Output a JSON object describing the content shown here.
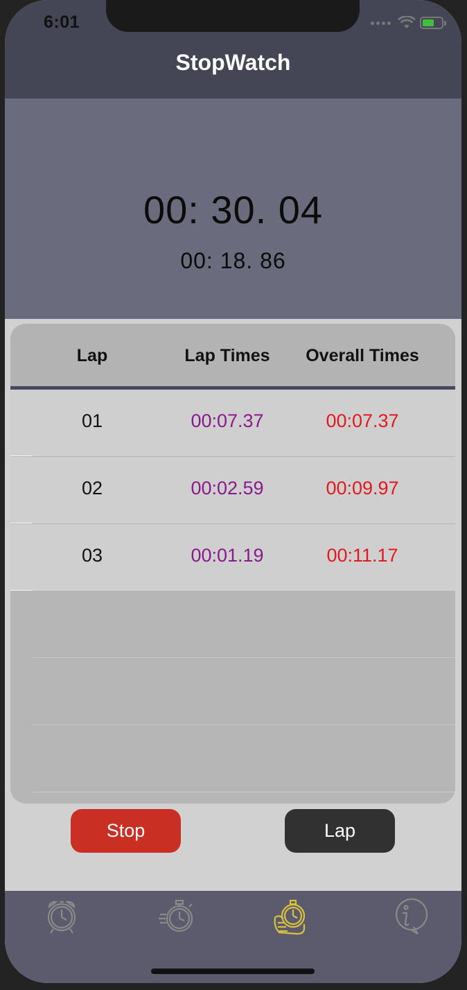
{
  "status_bar": {
    "time": "6:01"
  },
  "header": {
    "title": "StopWatch"
  },
  "timer": {
    "main": "00: 30. 04",
    "lap": "00: 18. 86"
  },
  "table": {
    "headers": [
      "Lap",
      "Lap Times",
      "Overall Times"
    ],
    "rows": [
      {
        "lap": "01",
        "lap_time": "00:07.37",
        "overall": "00:07.37"
      },
      {
        "lap": "02",
        "lap_time": "00:02.59",
        "overall": "00:09.97"
      },
      {
        "lap": "03",
        "lap_time": "00:01.19",
        "overall": "00:11.17"
      }
    ]
  },
  "controls": {
    "stop_label": "Stop",
    "lap_label": "Lap"
  },
  "tabs": [
    {
      "icon": "alarm-clock-icon",
      "active": false
    },
    {
      "icon": "timer-icon",
      "active": false
    },
    {
      "icon": "stopwatch-hand-icon",
      "active": true
    },
    {
      "icon": "info-bubble-icon",
      "active": false
    }
  ],
  "colors": {
    "header_bg": "#444555",
    "timer_bg": "#6a6b7d",
    "lap_time_text": "#8a1a8c",
    "overall_text": "#e3191e",
    "stop_button": "#c92f22",
    "lap_button": "#313131",
    "tab_active": "#d8c23a",
    "tab_inactive": "#8a8a8a"
  }
}
